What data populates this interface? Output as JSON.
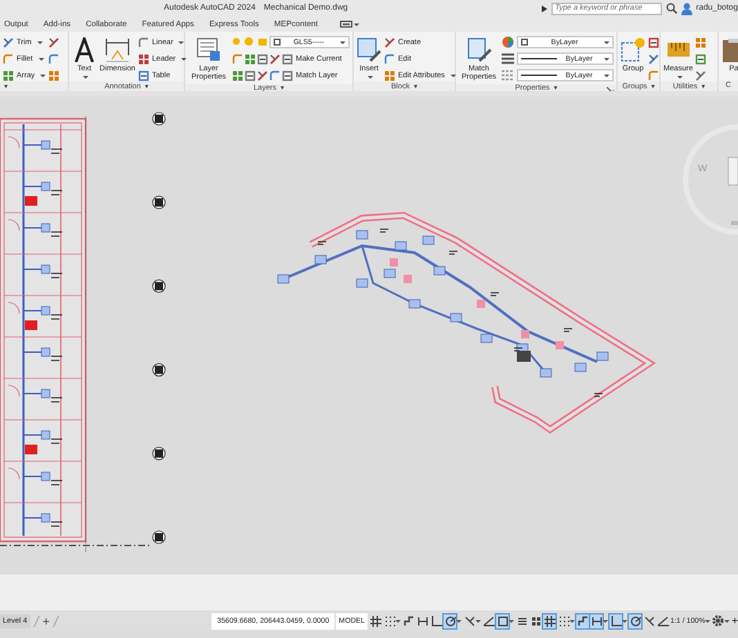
{
  "title_bar": {
    "app": "Autodesk AutoCAD 2024",
    "file": "Mechanical Demo.dwg",
    "search": {
      "placeholder": "Type a keyword or phrase"
    },
    "user": "radu_botog"
  },
  "ribbon_tabs": [
    {
      "label": "Output",
      "selected": false
    },
    {
      "label": "Add-ins",
      "selected": false
    },
    {
      "label": "Collaborate",
      "selected": false
    },
    {
      "label": "Featured Apps",
      "selected": false
    },
    {
      "label": "Express Tools",
      "selected": false
    },
    {
      "label": "MEPcontent",
      "selected": false
    }
  ],
  "panels": [
    {
      "menu": "▾",
      "columns": [
        [
          {
            "kind": "small",
            "label": "Trim",
            "caret": true
          },
          {
            "kind": "small",
            "label": "Fillet",
            "caret": true
          },
          {
            "kind": "small",
            "label": "Array",
            "caret": true
          }
        ],
        [
          {
            "kind": "icon"
          },
          {
            "kind": "icon"
          },
          {
            "kind": "icon"
          }
        ]
      ]
    },
    {
      "title": "Annotation",
      "menu": "▾",
      "columns": [
        [
          {
            "kind": "large",
            "label": "Text",
            "caret": true
          }
        ],
        [
          {
            "kind": "large",
            "label": "Dimension",
            "caret": false
          }
        ],
        [
          {
            "kind": "small",
            "label": "Linear",
            "caret": true
          },
          {
            "kind": "small",
            "label": "Leader",
            "caret": true
          },
          {
            "kind": "small",
            "label": "Table",
            "caret": false
          }
        ]
      ]
    },
    {
      "title": "Layers",
      "menu": "▾",
      "columns": [
        [
          {
            "kind": "large",
            "label": "Layer Properties",
            "caret": false
          }
        ],
        [
          {
            "kind": "combo",
            "value": "GLS5-----"
          },
          {
            "kind": "layer_tool",
            "label": "Make Current"
          },
          {
            "kind": "layer_tool",
            "label": "Match Layer"
          }
        ]
      ]
    },
    {
      "title": "Block",
      "menu": "▾",
      "columns": [
        [
          {
            "kind": "large",
            "label": "Insert",
            "caret": true
          }
        ],
        [
          {
            "kind": "small",
            "label": "Create",
            "caret": false
          },
          {
            "kind": "small",
            "label": "Edit",
            "caret": false
          },
          {
            "kind": "small",
            "label": "Edit Attributes",
            "caret": true
          }
        ]
      ]
    },
    {
      "title": "Properties",
      "menu": "▾",
      "launcher": true,
      "columns": [
        [
          {
            "kind": "large",
            "label": "Match Properties",
            "caret": false
          }
        ],
        [
          {
            "kind": "combo",
            "value": "ByLayer"
          },
          {
            "kind": "combo",
            "value": "ByLayer"
          },
          {
            "kind": "combo",
            "value": "ByLayer"
          }
        ]
      ]
    },
    {
      "title": "Groups",
      "menu": "▾",
      "columns": [
        [
          {
            "kind": "large",
            "label": "Group",
            "caret": false
          }
        ],
        [
          {
            "kind": "icon"
          },
          {
            "kind": "icon"
          },
          {
            "kind": "icon"
          }
        ]
      ]
    },
    {
      "title": "Utilities",
      "menu": "▾",
      "columns": [
        [
          {
            "kind": "large",
            "label": "Measure",
            "caret": true
          }
        ],
        [
          {
            "kind": "icon"
          },
          {
            "kind": "icon"
          },
          {
            "kind": "icon"
          }
        ]
      ]
    },
    {
      "title": "C",
      "columns": [
        [
          {
            "kind": "large",
            "label": "Pa",
            "caret": false
          }
        ]
      ]
    }
  ],
  "viewcube": {
    "direction": "W"
  },
  "layout_tabs": [
    {
      "label": "Level 4",
      "selected": true
    }
  ],
  "add_layout": "+",
  "coordinates": "35609.6680, 206443.0459, 0.0000",
  "space": "MODEL",
  "toggles": [
    {
      "on": false,
      "caret": false
    },
    {
      "on": false,
      "caret": true
    },
    {
      "on": false,
      "caret": false
    },
    {
      "on": false,
      "caret": false
    },
    {
      "on": false,
      "caret": false
    },
    {
      "on": true,
      "caret": true
    },
    {
      "on": false,
      "caret": true
    },
    {
      "on": false,
      "caret": false
    },
    {
      "on": true,
      "caret": true
    },
    {
      "on": false,
      "caret": false
    },
    {
      "on": false,
      "caret": false
    },
    {
      "on": true,
      "caret": false
    },
    {
      "on": false,
      "caret": true
    },
    {
      "on": true,
      "caret": false
    },
    {
      "on": true,
      "caret": true
    },
    {
      "on": true,
      "caret": true
    },
    {
      "on": true,
      "caret": false
    },
    {
      "on": false,
      "caret": false
    },
    {
      "on": false,
      "caret": false
    }
  ],
  "scale": "1:1 / 100%",
  "end_button": "+"
}
